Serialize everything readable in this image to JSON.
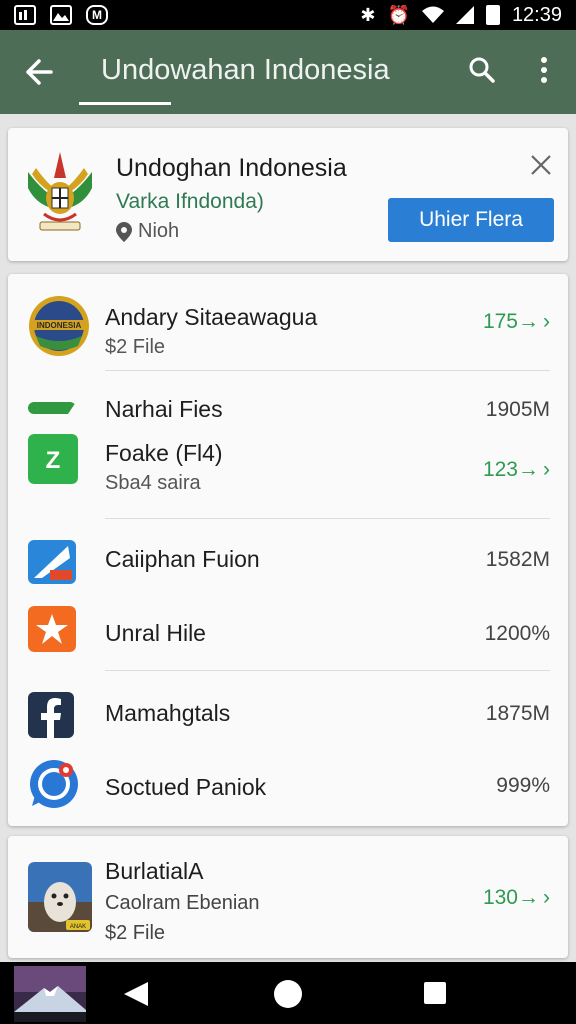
{
  "status_bar": {
    "time": "12:39",
    "icons": [
      "image-icon",
      "gallery-icon",
      "gmail-icon",
      "bluetooth-icon",
      "alarm-icon",
      "wifi-icon",
      "signal-icon",
      "battery-icon"
    ]
  },
  "app_bar": {
    "title": "Undowahan Indonesia"
  },
  "header_card": {
    "title": "Undoghan Indonesia",
    "subtitle": "Varka Ifndonda)",
    "location": "Nioh",
    "button_label": "Uhier Flera"
  },
  "list_items": [
    {
      "title": "Andary Sitaeawagua",
      "subtitle": "$2 File",
      "value": "175→",
      "green": true,
      "chevron": "›"
    },
    {
      "title": "Narhai Fies",
      "subtitle": "",
      "value": "1905M",
      "green": false,
      "chevron": ""
    },
    {
      "title": "Foake (Fl4)",
      "subtitle": "Sba4 saira",
      "value": "123→",
      "green": true,
      "chevron": "›"
    },
    {
      "title": "Caiiphan Fuion",
      "subtitle": "",
      "value": "1582M",
      "green": false,
      "chevron": ""
    },
    {
      "title": "Unral Hile",
      "subtitle": "",
      "value": "1200%",
      "green": false,
      "chevron": ""
    },
    {
      "title": "Mamahgtals",
      "subtitle": "",
      "value": "1875M",
      "green": false,
      "chevron": ""
    },
    {
      "title": "Soctued Paniok",
      "subtitle": "",
      "value": "999%",
      "green": false,
      "chevron": ""
    }
  ],
  "bottom_item": {
    "title": "BurlatialA",
    "subtitle": "Caolram Ebenian",
    "meta": "$2 File",
    "value": "130→",
    "chevron": "›",
    "badge": "ANAK"
  },
  "first_icon_text": "INDONESIA",
  "colors": {
    "app_bar": "#4d6d57",
    "accent_green": "#2f9a53",
    "button_blue": "#2a7fd4"
  }
}
